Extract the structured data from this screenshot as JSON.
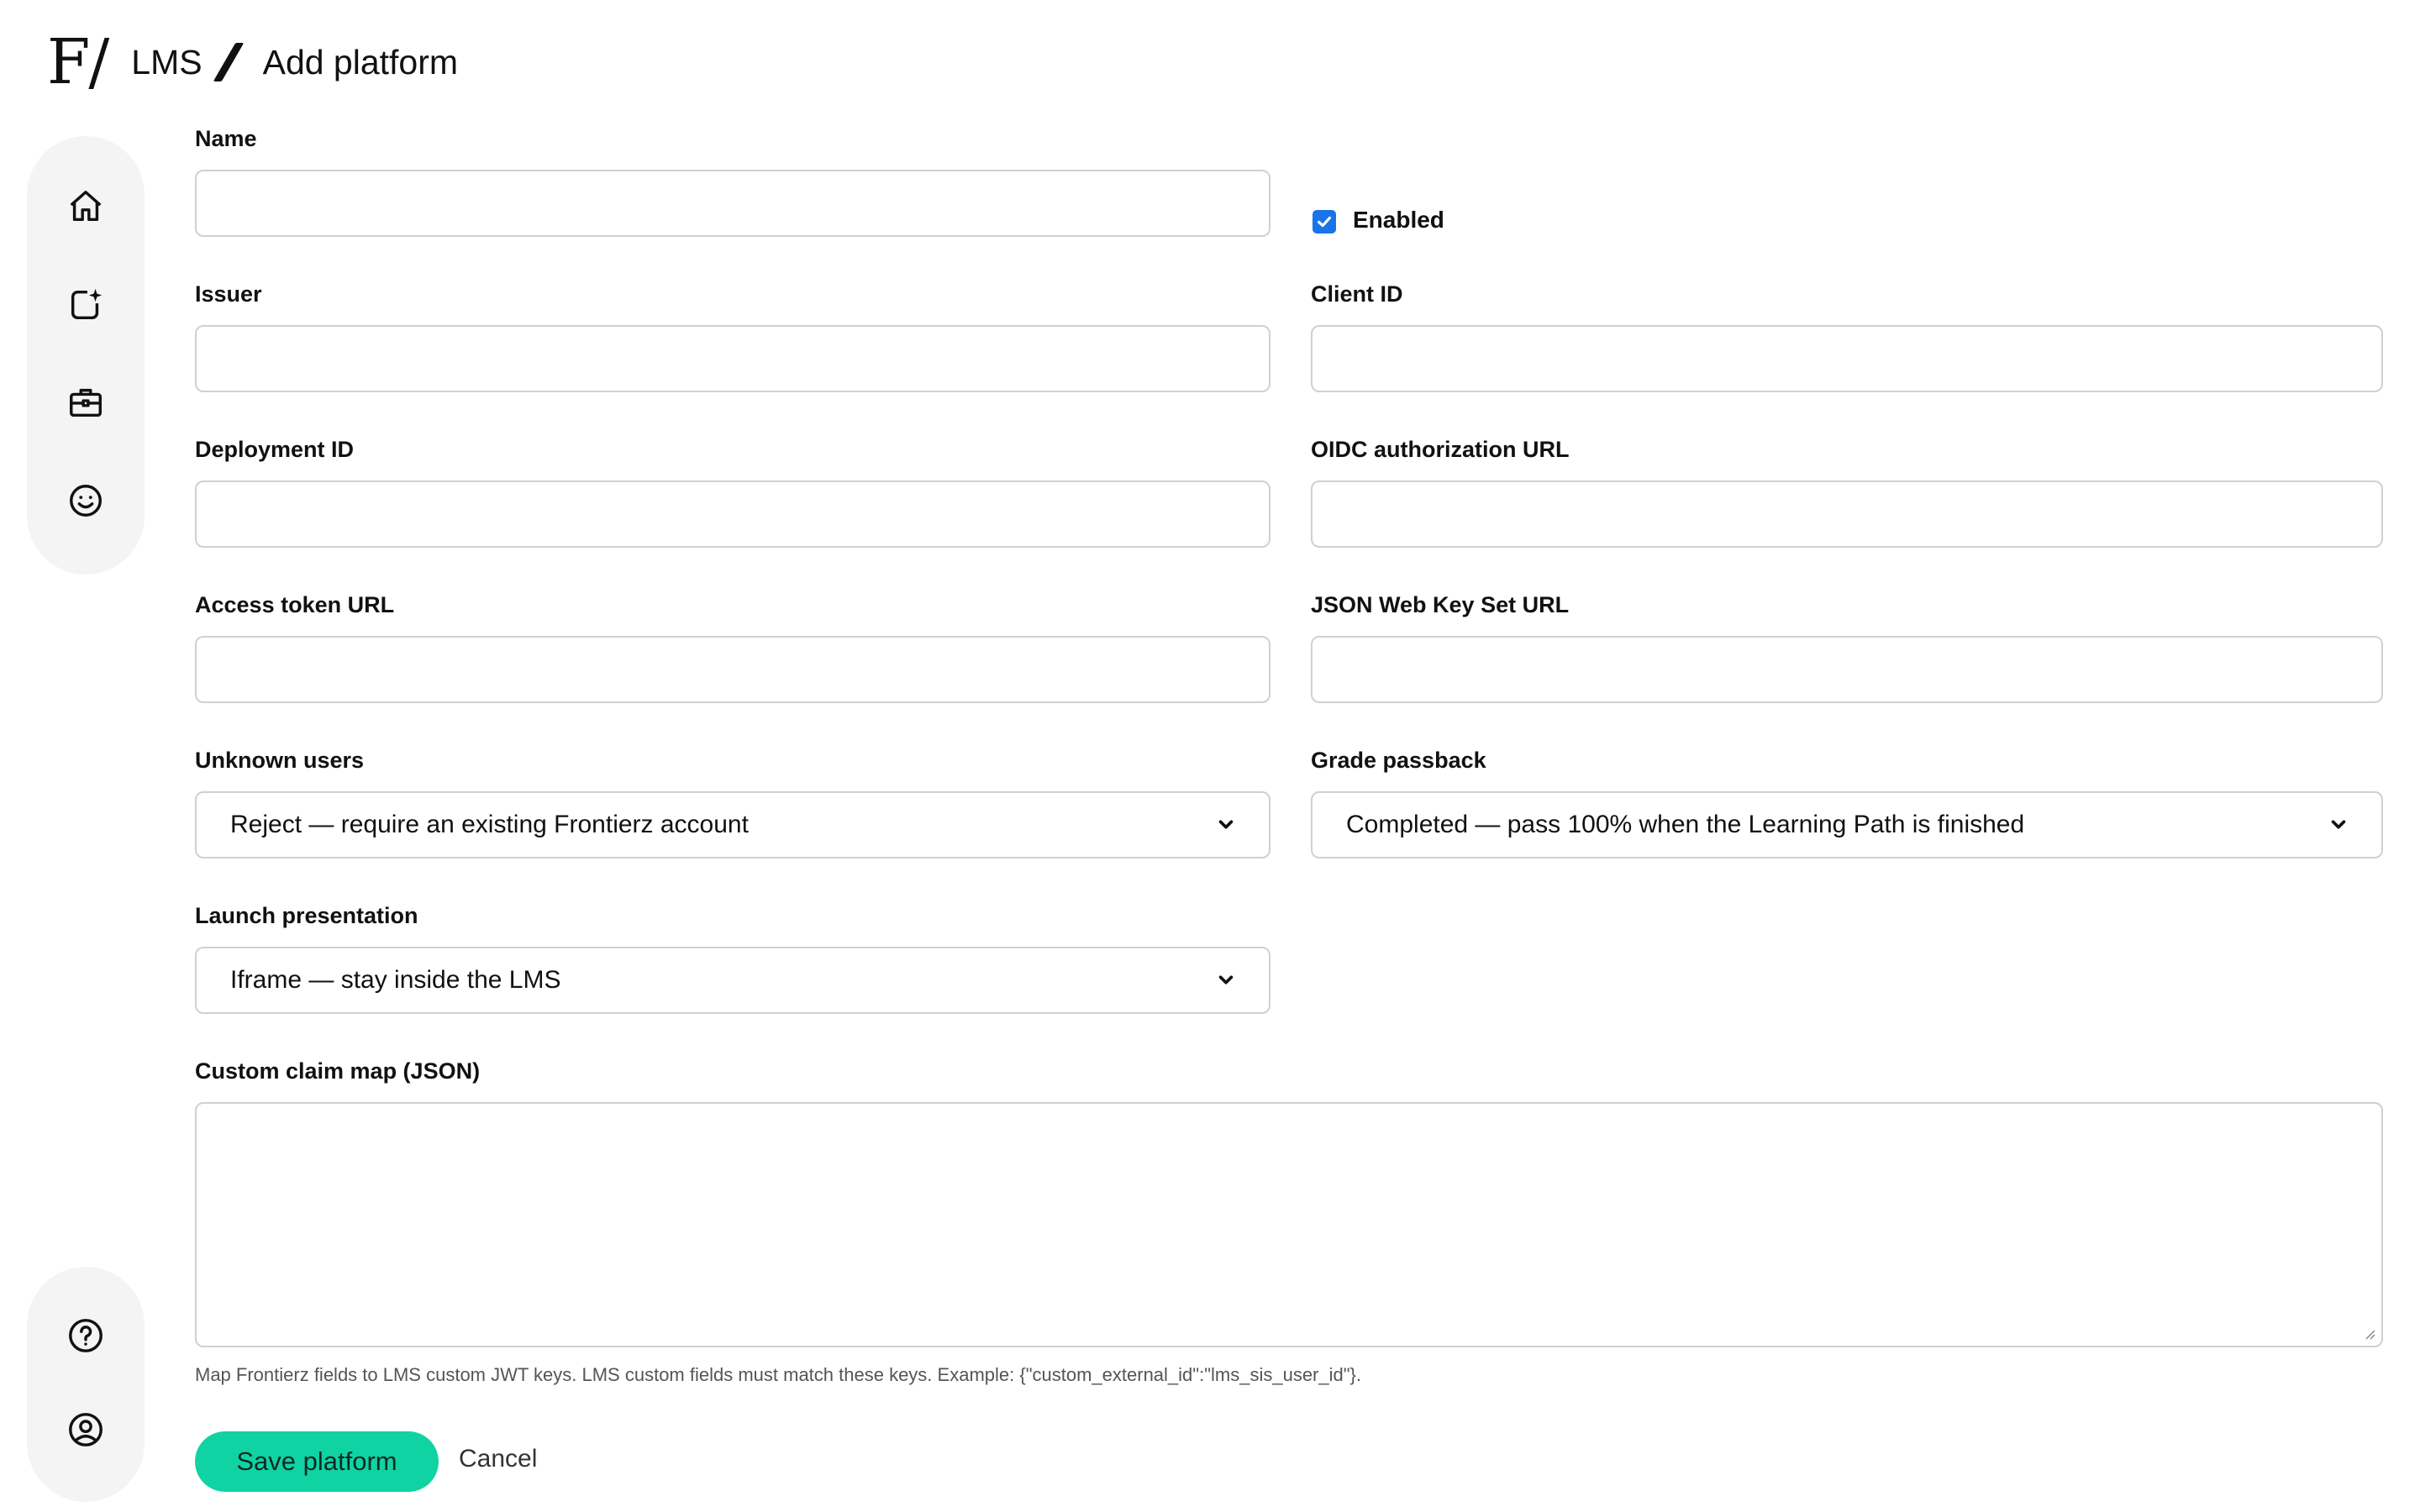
{
  "header": {
    "logo": "F/",
    "breadcrumb_root": "LMS",
    "breadcrumb_current": "Add platform"
  },
  "sidebar": {
    "top_items": [
      {
        "icon": "home-icon"
      },
      {
        "icon": "new-content-icon"
      },
      {
        "icon": "briefcase-icon"
      },
      {
        "icon": "smiley-icon"
      }
    ],
    "bottom_items": [
      {
        "icon": "help-icon"
      },
      {
        "icon": "account-icon"
      }
    ]
  },
  "form": {
    "name": {
      "label": "Name",
      "value": ""
    },
    "enabled": {
      "label": "Enabled",
      "checked": true
    },
    "issuer": {
      "label": "Issuer",
      "value": ""
    },
    "client_id": {
      "label": "Client ID",
      "value": ""
    },
    "deployment_id": {
      "label": "Deployment ID",
      "value": ""
    },
    "oidc_url": {
      "label": "OIDC authorization URL",
      "value": ""
    },
    "access_token_url": {
      "label": "Access token URL",
      "value": ""
    },
    "jwks_url": {
      "label": "JSON Web Key Set URL",
      "value": ""
    },
    "unknown_users": {
      "label": "Unknown users",
      "selected": "Reject — require an existing Frontierz account"
    },
    "grade_passback": {
      "label": "Grade passback",
      "selected": "Completed — pass 100% when the Learning Path is finished"
    },
    "launch_presentation": {
      "label": "Launch presentation",
      "selected": "Iframe — stay inside the LMS"
    },
    "claim_map": {
      "label": "Custom claim map (JSON)",
      "value": "",
      "help": "Map Frontierz fields to LMS custom JWT keys. LMS custom fields must match these keys. Example: {\"custom_external_id\":\"lms_sis_user_id\"}."
    }
  },
  "actions": {
    "save_label": "Save platform",
    "cancel_label": "Cancel"
  },
  "colors": {
    "accent": "#10d3a3",
    "checkbox": "#1a73e8",
    "rail": "#f4f4f4",
    "border": "#d0d0d0"
  }
}
